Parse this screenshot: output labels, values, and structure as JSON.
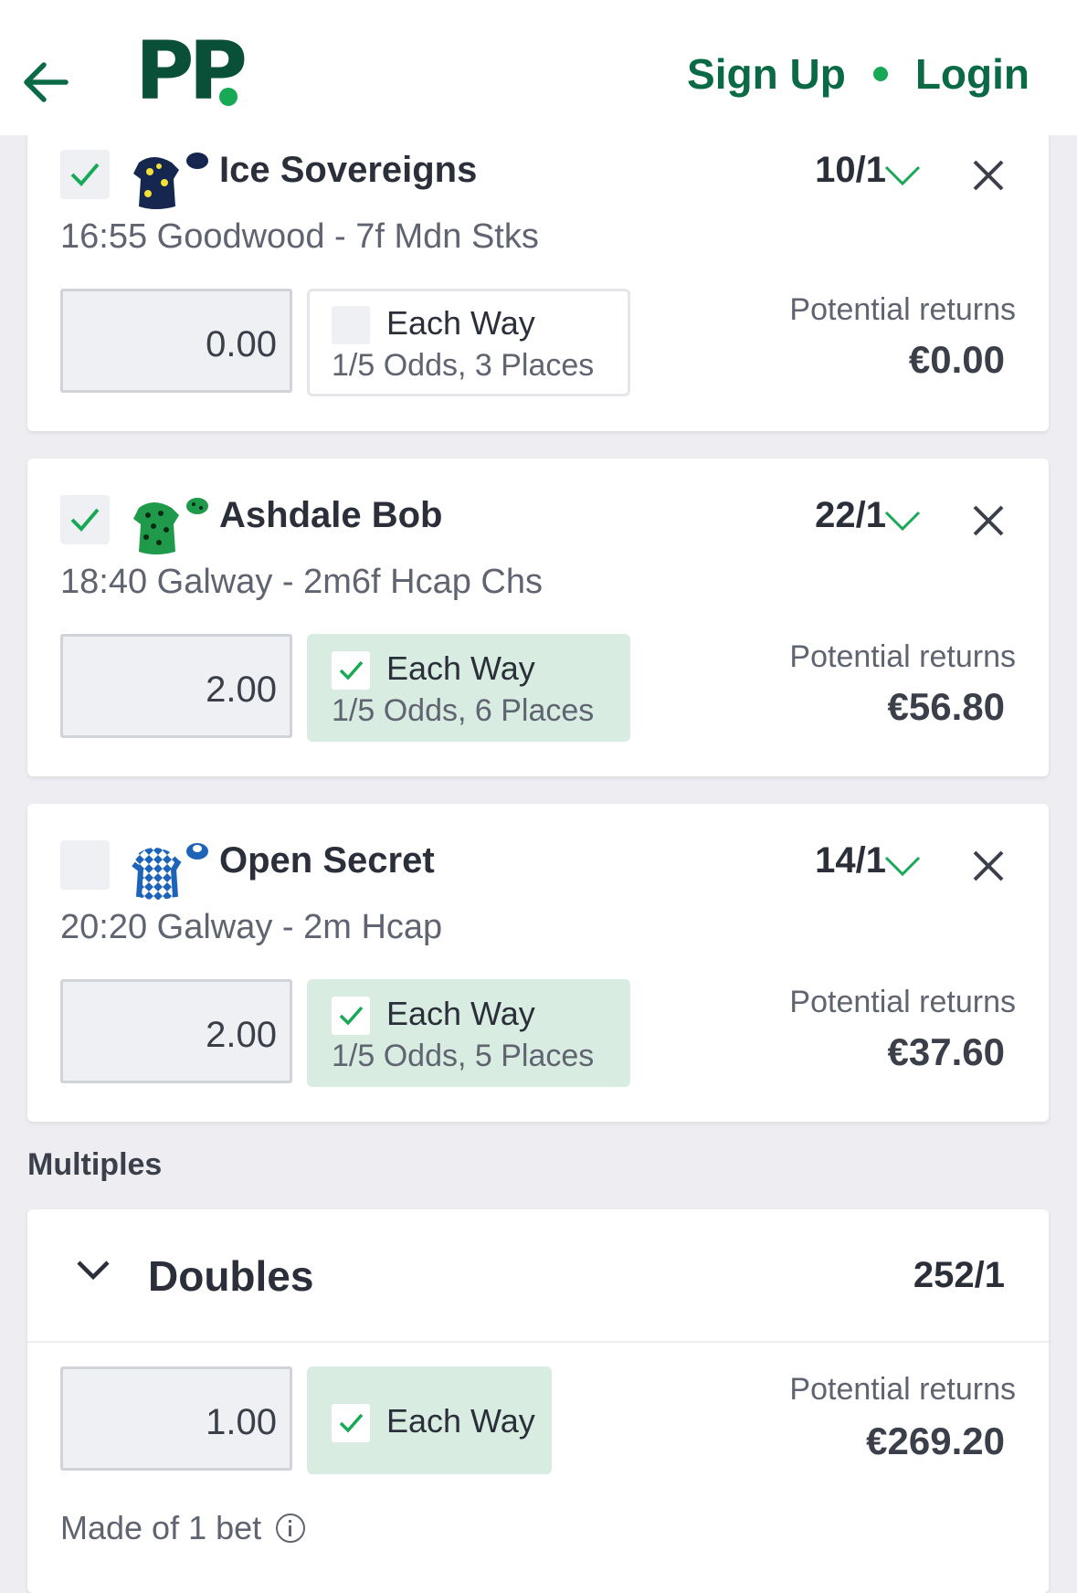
{
  "header": {
    "logo_text": "PP",
    "signup_label": "Sign Up",
    "login_label": "Login",
    "colors": {
      "brand": "#0a4f37",
      "accent": "#18a957"
    }
  },
  "selections": [
    {
      "checked": true,
      "silks_icon": "navy-silks-yellow-spots-icon",
      "name": "Ice Sovereigns",
      "odds": "10/1",
      "race": "16:55 Goodwood - 7f Mdn Stks",
      "stake": "0.00",
      "each_way": {
        "checked": false,
        "label": "Each Way",
        "terms": "1/5 Odds, 3 Places"
      },
      "returns_label": "Potential returns",
      "returns_value": "€0.00"
    },
    {
      "checked": true,
      "silks_icon": "green-silks-black-stars-icon",
      "name": "Ashdale Bob",
      "odds": "22/1",
      "race": "18:40 Galway - 2m6f Hcap Chs",
      "stake": "2.00",
      "each_way": {
        "checked": true,
        "label": "Each Way",
        "terms": "1/5 Odds, 6 Places"
      },
      "returns_label": "Potential returns",
      "returns_value": "€56.80"
    },
    {
      "checked": false,
      "silks_icon": "blue-white-diamonds-silks-icon",
      "name": "Open Secret",
      "odds": "14/1",
      "race": "20:20 Galway - 2m Hcap",
      "stake": "2.00",
      "each_way": {
        "checked": true,
        "label": "Each Way",
        "terms": "1/5 Odds, 5 Places"
      },
      "returns_label": "Potential returns",
      "returns_value": "€37.60"
    }
  ],
  "multiples": {
    "section_title": "Multiples",
    "doubles": {
      "title": "Doubles",
      "odds": "252/1",
      "stake": "1.00",
      "each_way_label": "Each Way",
      "each_way_checked": true,
      "returns_label": "Potential returns",
      "returns_value": "€269.20",
      "made_of": "Made of 1 bet"
    }
  }
}
